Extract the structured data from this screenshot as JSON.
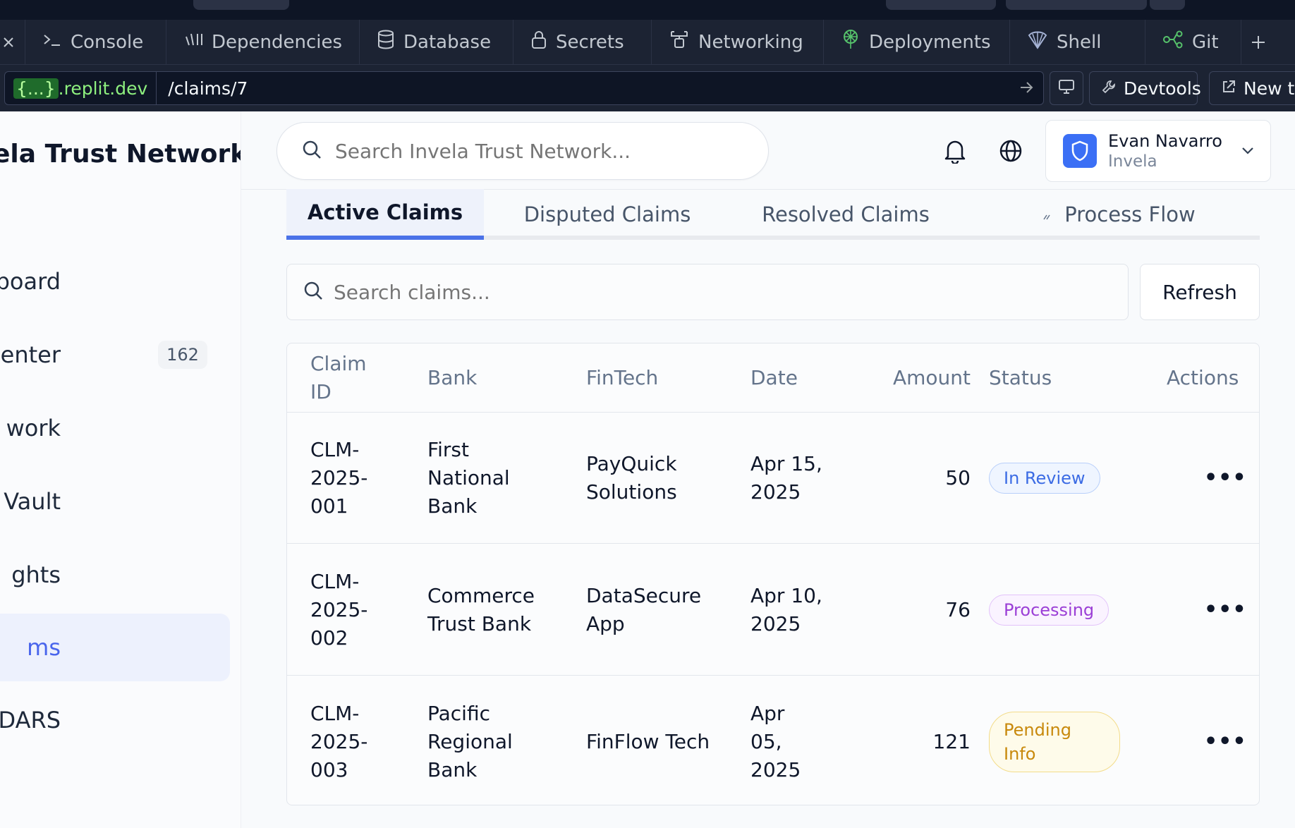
{
  "ide": {
    "tabs": [
      {
        "label": "Console",
        "icon": "terminal-icon"
      },
      {
        "label": "Dependencies",
        "icon": "dependencies-icon"
      },
      {
        "label": "Database",
        "icon": "database-icon"
      },
      {
        "label": "Secrets",
        "icon": "lock-icon"
      },
      {
        "label": "Networking",
        "icon": "network-icon"
      },
      {
        "label": "Deployments",
        "icon": "deploy-icon"
      },
      {
        "label": "Shell",
        "icon": "shell-icon"
      },
      {
        "label": "Git",
        "icon": "git-icon"
      }
    ],
    "address": {
      "domain_brace": "{...}",
      "domain": ".replit.dev",
      "path": "/claims/7"
    },
    "devtools_label": "Devtools",
    "newtab_label": "New ta"
  },
  "sidebar": {
    "brand": "ela Trust Network",
    "items": [
      {
        "label": "hboard"
      },
      {
        "label": "k Center",
        "badge": "162"
      },
      {
        "label": "work"
      },
      {
        "label": "Vault"
      },
      {
        "label": "ghts"
      },
      {
        "label": "ms",
        "active": true
      },
      {
        "label": "' DARS"
      }
    ]
  },
  "header": {
    "search_placeholder": "Search Invela Trust Network...",
    "user_name": "Evan Navarro",
    "user_org": "Invela"
  },
  "tabs": [
    {
      "label": "Active Claims",
      "active": true
    },
    {
      "label": "Disputed Claims"
    },
    {
      "label": "Resolved Claims"
    },
    {
      "label": "Process Flow"
    }
  ],
  "claims_search_placeholder": "Search claims...",
  "refresh_label": "Refresh",
  "table": {
    "headers": {
      "claim_id": "Claim ID",
      "bank": "Bank",
      "fintech": "FinTech",
      "date": "Date",
      "amount": "Amount",
      "status": "Status",
      "actions": "Actions"
    },
    "rows": [
      {
        "claim_id": "CLM-2025-001",
        "bank": "First National Bank",
        "fintech": "PayQuick Solutions",
        "date": "Apr 15, 2025",
        "amount": "50",
        "status": "In Review",
        "actions": "•••"
      },
      {
        "claim_id": "CLM-2025-002",
        "bank": "Commerce Trust Bank",
        "fintech": "DataSecure App",
        "date": "Apr 10, 2025",
        "amount": "76",
        "status": "Processing",
        "actions": "•••"
      },
      {
        "claim_id": "CLM-2025-003",
        "bank": "Pacific Regional Bank",
        "fintech": "FinFlow Tech",
        "date": "Apr 05, 2025",
        "amount": "121",
        "status": "Pending Info",
        "actions": "•••"
      }
    ]
  },
  "colors": {
    "accent": "#4a72e8",
    "in_review": "#3b6be4",
    "processing": "#9b3fd6",
    "pending": "#c8890c"
  }
}
